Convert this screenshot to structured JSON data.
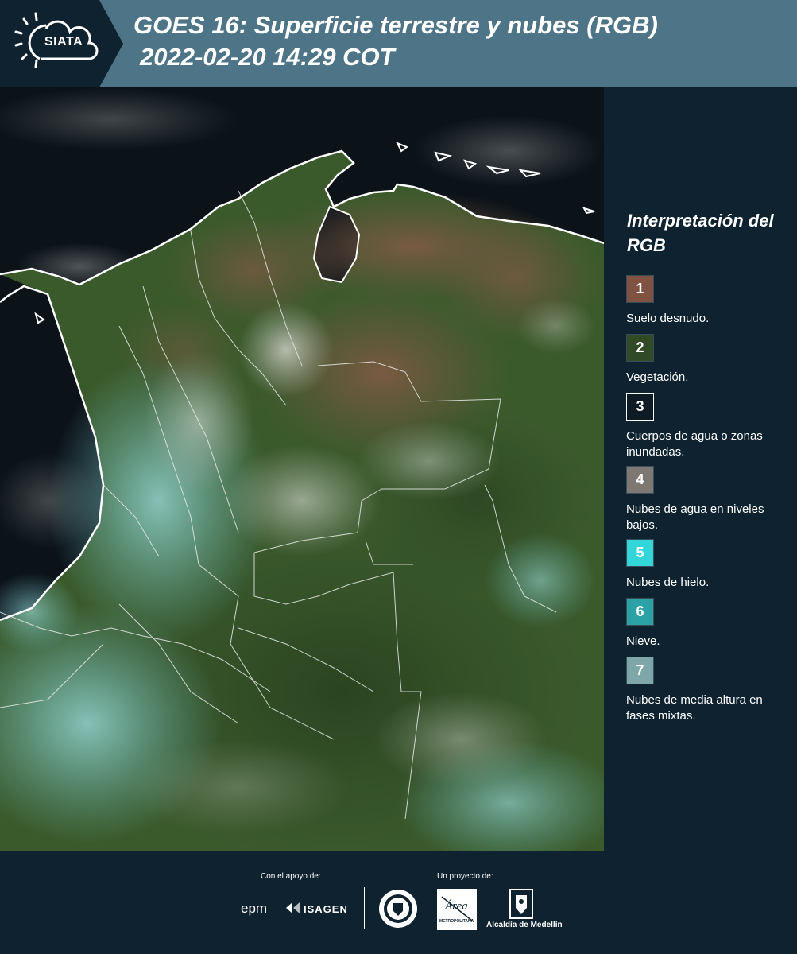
{
  "header": {
    "logo_text": "SIATA",
    "title_line1": "GOES 16: Superficie terrestre y nubes (RGB)",
    "title_line2": " 2022-02-20 14:29 COT",
    "background_color": "#4d7587"
  },
  "legend": {
    "title": "Interpretación del RGB",
    "items": [
      {
        "number": "1",
        "label": "Suelo desnudo.",
        "color": "#7f5241"
      },
      {
        "number": "2",
        "label": "Vegetación.",
        "color": "#2f4a25"
      },
      {
        "number": "3",
        "label": "Cuerpos de agua o zonas inundadas.",
        "color": "#0f1b24"
      },
      {
        "number": "4",
        "label": "Nubes de agua en niveles bajos.",
        "color": "#7e7870"
      },
      {
        "number": "5",
        "label": "Nubes de hielo.",
        "color": "#32d6d8"
      },
      {
        "number": "6",
        "label": "Nieve.",
        "color": "#2aa2a6"
      },
      {
        "number": "7",
        "label": "Nubes de media altura en fases mixtas.",
        "color": "#7fa7a9"
      }
    ]
  },
  "footer": {
    "support_caption": "Con el apoyo de:",
    "project_caption": "Un proyecto de:",
    "sponsors": [
      "epm",
      "ISAGEN"
    ],
    "area_logo_text": "Área",
    "area_logo_subtext": "METROPOLITANA",
    "alcaldia_label": "Alcaldía de Medellín"
  }
}
